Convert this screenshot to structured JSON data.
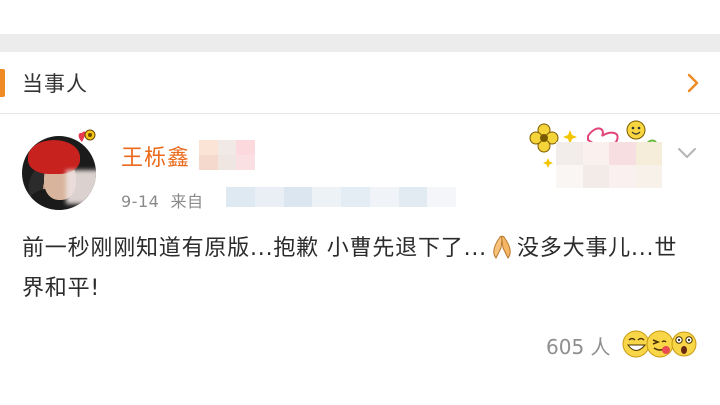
{
  "section": {
    "title": "当事人"
  },
  "post": {
    "author": "王栎鑫",
    "date": "9-14",
    "source_prefix": "来自",
    "text_part1": "前一秒刚刚知道有原版...抱歉 小曹先退下了...",
    "text_part2": "没多大事儿...世界和平!",
    "inline_emoji": "praying-hands-icon"
  },
  "reactions": {
    "count_label": "605 人",
    "emojis": [
      "laughing-face-icon",
      "hugging-face-icon",
      "surprised-face-icon"
    ]
  },
  "colors": {
    "accent": "#f08a24",
    "username": "#eb6a1c",
    "gap_band": "#ececec"
  }
}
